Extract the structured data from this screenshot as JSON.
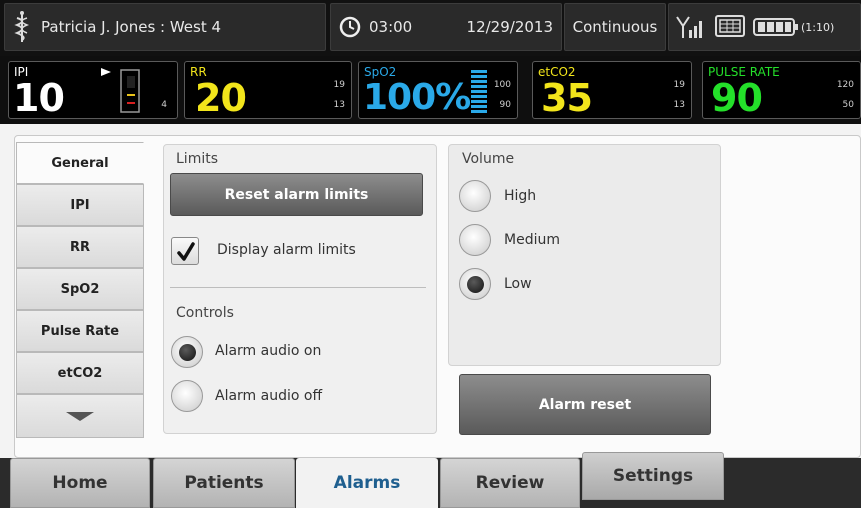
{
  "header": {
    "patient": "Patricia J. Jones : West 4",
    "clock": "03:00",
    "date": "12/29/2013",
    "mode": "Continuous",
    "battery": "(1:10)"
  },
  "vitals": {
    "ipi": {
      "label": "IPI",
      "value": "10",
      "lo": "4",
      "color": "#ffffff"
    },
    "rr": {
      "label": "RR",
      "value": "20",
      "hi": "19",
      "lo": "13",
      "color": "#f2e51b"
    },
    "spo2": {
      "label": "SpO2",
      "value": "100%",
      "hi": "100",
      "lo": "90",
      "color": "#2aa9e8"
    },
    "etco2": {
      "label": "etCO2",
      "value": "35",
      "hi": "19",
      "lo": "13",
      "color": "#f2e51b"
    },
    "pulse": {
      "label": "PULSE RATE",
      "value": "90",
      "hi": "120",
      "lo": "50",
      "color": "#24e02a"
    }
  },
  "sidetabs": {
    "items": [
      "General",
      "IPI",
      "RR",
      "SpO2",
      "Pulse Rate",
      "etCO2"
    ],
    "active": "General"
  },
  "limits": {
    "title": "Limits",
    "reset_label": "Reset alarm limits",
    "display_label": "Display alarm limits",
    "display_checked": true
  },
  "controls": {
    "title": "Controls",
    "audio_on": "Alarm audio on",
    "audio_off": "Alarm audio off",
    "selected": "Alarm audio on"
  },
  "volume": {
    "title": "Volume",
    "options": [
      "High",
      "Medium",
      "Low"
    ],
    "selected": "Low"
  },
  "alarm_reset_label": "Alarm reset",
  "nav": {
    "items": [
      "Home",
      "Patients",
      "Alarms",
      "Review",
      "Settings"
    ],
    "active": "Alarms"
  }
}
